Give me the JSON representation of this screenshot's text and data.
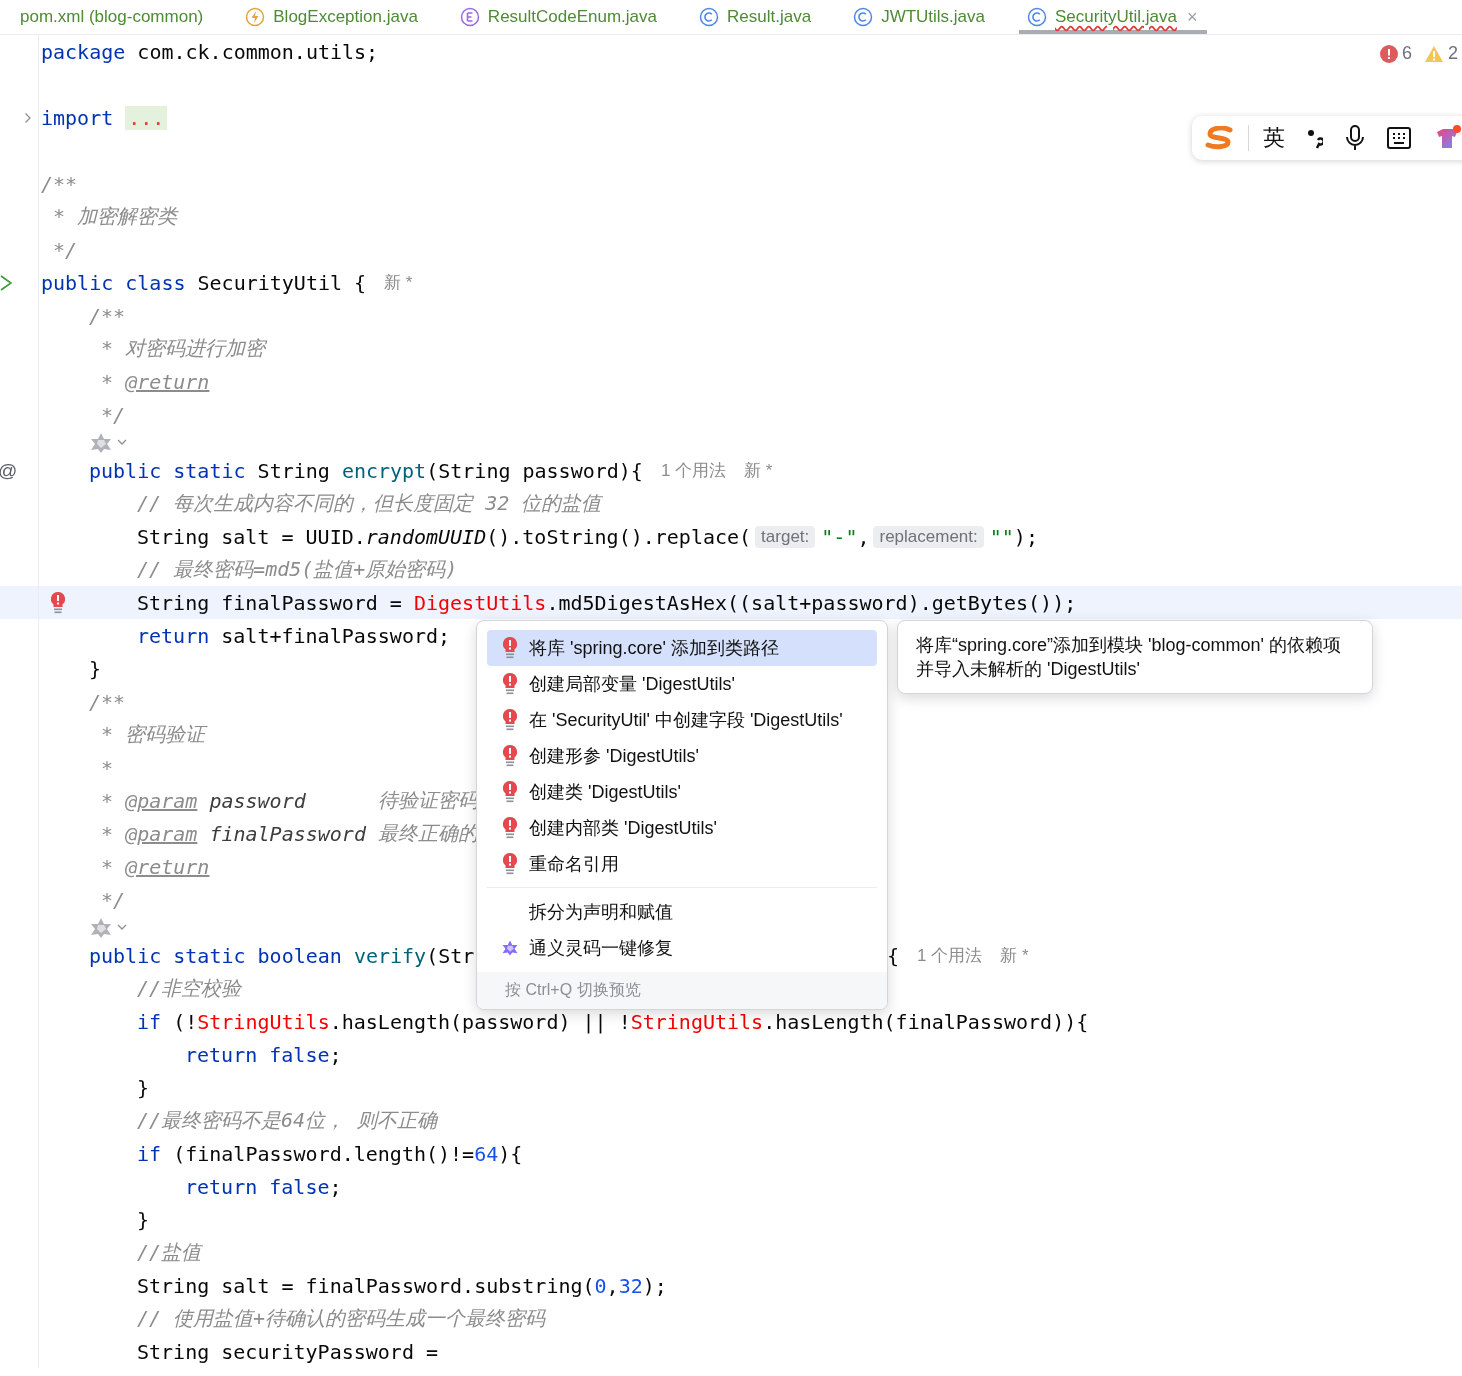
{
  "tabs": [
    {
      "kind": "xml",
      "label": "pom.xml (blog-common)",
      "selected": false,
      "has_error": false
    },
    {
      "kind": "exception",
      "label": "BlogException.java",
      "selected": false,
      "has_error": false
    },
    {
      "kind": "enum",
      "label": "ResultCodeEnum.java",
      "selected": false,
      "has_error": false
    },
    {
      "kind": "class",
      "label": "Result.java",
      "selected": false,
      "has_error": false
    },
    {
      "kind": "class",
      "label": "JWTUtils.java",
      "selected": false,
      "has_error": false
    },
    {
      "kind": "class",
      "label": "SecurityUtil.java",
      "selected": true,
      "has_error": true,
      "close": "×"
    }
  ],
  "problems": {
    "errors": "6",
    "warnings": "2"
  },
  "ime_toolbar": {
    "mode": "英"
  },
  "lines": [
    {
      "kind": "code",
      "tokens": [
        {
          "kind": "kw",
          "t": "package"
        },
        {
          "kind": "plain",
          "t": " com.ck.common.utils;"
        }
      ]
    },
    {
      "kind": "blank"
    },
    {
      "kind": "code",
      "gutter": {
        "kind": "fold"
      },
      "tokens": [
        {
          "kind": "kw",
          "t": "import"
        },
        {
          "kind": "fold",
          "t": "..."
        }
      ]
    },
    {
      "kind": "blank"
    },
    {
      "kind": "code",
      "tokens": [
        {
          "kind": "cmt",
          "t": "/**"
        }
      ]
    },
    {
      "kind": "code",
      "tokens": [
        {
          "kind": "cmt",
          "t": " * 加密解密类"
        }
      ]
    },
    {
      "kind": "code",
      "tokens": [
        {
          "kind": "cmt",
          "t": " */"
        }
      ]
    },
    {
      "kind": "code",
      "gutter": {
        "kind": "run"
      },
      "tokens": [
        {
          "kind": "kw",
          "t": "public class"
        },
        {
          "kind": "plain",
          "t": " SecurityUtil {"
        },
        {
          "kind": "meta",
          "t": "新 *"
        }
      ],
      "children": [
        {
          "kind": "code",
          "tokens": [
            {
              "kind": "cmt",
              "t": "/**"
            }
          ]
        },
        {
          "kind": "code",
          "tokens": [
            {
              "kind": "cmt",
              "t": " * 对密码进行加密"
            }
          ]
        },
        {
          "kind": "code",
          "tokens": [
            {
              "kind": "cmt",
              "t": " * "
            },
            {
              "kind": "tag",
              "t": "@return"
            }
          ]
        },
        {
          "kind": "code",
          "tokens": [
            {
              "kind": "cmt",
              "t": " */"
            }
          ]
        },
        {
          "kind": "inlay"
        },
        {
          "kind": "code",
          "gutter": {
            "kind": "mark",
            "text": "@"
          },
          "tokens": [
            {
              "kind": "kw",
              "t": "public static"
            },
            {
              "kind": "plain",
              "t": " String "
            },
            {
              "kind": "fn",
              "t": "encrypt"
            },
            {
              "kind": "plain",
              "t": "(String password){"
            },
            {
              "kind": "meta",
              "t": "1 个用法"
            },
            {
              "kind": "meta",
              "t": "新 *"
            }
          ],
          "children": [
            {
              "kind": "code",
              "tokens": [
                {
                  "kind": "cmt",
                  "t": "// 每次生成内容不同的，但长度固定 32 位的盐值"
                }
              ]
            },
            {
              "kind": "code",
              "tokens": [
                {
                  "kind": "plain",
                  "t": "String salt = UUID."
                },
                {
                  "kind": "ital",
                  "t": "randomUUID"
                },
                {
                  "kind": "plain",
                  "t": "().toString().replace("
                },
                {
                  "kind": "hint",
                  "t": "target:"
                },
                {
                  "kind": "str",
                  "t": "\"-\""
                },
                {
                  "kind": "plain",
                  "t": ","
                },
                {
                  "kind": "hint",
                  "t": "replacement:"
                },
                {
                  "kind": "str",
                  "t": "\"\""
                },
                {
                  "kind": "plain",
                  "t": ");"
                }
              ]
            },
            {
              "kind": "code",
              "tokens": [
                {
                  "kind": "cmt",
                  "t": "// 最终密码=md5(盐值+原始密码)"
                }
              ]
            },
            {
              "kind": "code",
              "current": true,
              "error_bulb": true,
              "tokens": [
                {
                  "kind": "plain",
                  "t": "String finalPassword = "
                },
                {
                  "kind": "err",
                  "t": "DigestUtils"
                },
                {
                  "kind": "plain",
                  "t": ".md5DigestAsHex((salt+password).getBytes());"
                }
              ]
            },
            {
              "kind": "code",
              "tokens": [
                {
                  "kind": "kw",
                  "t": "return"
                },
                {
                  "kind": "plain",
                  "t": " salt+finalPassword;"
                }
              ]
            }
          ]
        },
        {
          "kind": "code",
          "tokens": [
            {
              "kind": "plain",
              "t": "}"
            }
          ]
        },
        {
          "kind": "code",
          "tokens": [
            {
              "kind": "cmt",
              "t": "/**"
            }
          ]
        },
        {
          "kind": "code",
          "tokens": [
            {
              "kind": "cmt",
              "t": " * 密码验证"
            }
          ]
        },
        {
          "kind": "code",
          "tokens": [
            {
              "kind": "cmt",
              "t": " *"
            }
          ]
        },
        {
          "kind": "code",
          "tokens": [
            {
              "kind": "cmt",
              "t": " * "
            },
            {
              "kind": "tag",
              "t": "@param"
            },
            {
              "kind": "docp",
              "t": " password"
            },
            {
              "kind": "cmt",
              "t": "      待验证密码"
            }
          ]
        },
        {
          "kind": "code",
          "tokens": [
            {
              "kind": "cmt",
              "t": " * "
            },
            {
              "kind": "tag",
              "t": "@param"
            },
            {
              "kind": "docp",
              "t": " finalPassword"
            },
            {
              "kind": "cmt",
              "t": " 最终正确的"
            }
          ]
        },
        {
          "kind": "code",
          "tokens": [
            {
              "kind": "cmt",
              "t": " * "
            },
            {
              "kind": "tag",
              "t": "@return"
            }
          ]
        },
        {
          "kind": "code",
          "tokens": [
            {
              "kind": "cmt",
              "t": " */"
            }
          ]
        },
        {
          "kind": "inlay"
        },
        {
          "kind": "code",
          "tokens": [
            {
              "kind": "kw",
              "t": "public static boolean"
            },
            {
              "kind": "fn",
              "t": " verify"
            },
            {
              "kind": "plain",
              "t": "(Str"
            }
          ],
          "after": [
            {
              "kind": "plain",
              "t": "{"
            },
            {
              "kind": "meta",
              "t": "1 个用法"
            },
            {
              "kind": "meta",
              "t": "新 *"
            }
          ],
          "children": [
            {
              "kind": "code",
              "tokens": [
                {
                  "kind": "cmt",
                  "t": "//非空校验"
                }
              ]
            },
            {
              "kind": "code",
              "tokens": [
                {
                  "kind": "kw",
                  "t": "if"
                },
                {
                  "kind": "plain",
                  "t": " (!"
                },
                {
                  "kind": "err",
                  "t": "StringUtils"
                },
                {
                  "kind": "plain",
                  "t": ".hasLength(password) || !"
                },
                {
                  "kind": "err",
                  "t": "StringUtils"
                },
                {
                  "kind": "plain",
                  "t": ".hasLength(finalPassword)){"
                }
              ],
              "children": [
                {
                  "kind": "code",
                  "tokens": [
                    {
                      "kind": "kw",
                      "t": "return false"
                    },
                    {
                      "kind": "plain",
                      "t": ";"
                    }
                  ]
                }
              ]
            },
            {
              "kind": "code",
              "tokens": [
                {
                  "kind": "plain",
                  "t": "}"
                }
              ]
            },
            {
              "kind": "code",
              "tokens": [
                {
                  "kind": "cmt",
                  "t": "//最终密码不是64位， 则不正确"
                }
              ]
            },
            {
              "kind": "code",
              "tokens": [
                {
                  "kind": "kw",
                  "t": "if"
                },
                {
                  "kind": "plain",
                  "t": " (finalPassword.length()!="
                },
                {
                  "kind": "num",
                  "t": "64"
                },
                {
                  "kind": "plain",
                  "t": "){"
                }
              ],
              "children": [
                {
                  "kind": "code",
                  "tokens": [
                    {
                      "kind": "kw",
                      "t": "return false"
                    },
                    {
                      "kind": "plain",
                      "t": ";"
                    }
                  ]
                }
              ]
            },
            {
              "kind": "code",
              "tokens": [
                {
                  "kind": "plain",
                  "t": "}"
                }
              ]
            },
            {
              "kind": "code",
              "tokens": [
                {
                  "kind": "cmt",
                  "t": "//盐值"
                }
              ]
            },
            {
              "kind": "code",
              "tokens": [
                {
                  "kind": "plain",
                  "t": "String salt = finalPassword.substring("
                },
                {
                  "kind": "num",
                  "t": "0"
                },
                {
                  "kind": "plain",
                  "t": ","
                },
                {
                  "kind": "num",
                  "t": "32"
                },
                {
                  "kind": "plain",
                  "t": ");"
                }
              ]
            },
            {
              "kind": "code",
              "tokens": [
                {
                  "kind": "cmt",
                  "t": "// 使用盐值+待确认的密码生成一个最终密码"
                }
              ]
            },
            {
              "kind": "code",
              "tokens": [
                {
                  "kind": "plain",
                  "t": "String securityPassword ="
                }
              ]
            }
          ]
        }
      ]
    }
  ],
  "quick_fix_menu": {
    "items": [
      {
        "kind": "error",
        "label": "将库 'spring.core' 添加到类路径",
        "selected": true
      },
      {
        "kind": "error",
        "label": "创建局部变量 'DigestUtils'",
        "selected": false
      },
      {
        "kind": "error",
        "label": "在 'SecurityUtil' 中创建字段 'DigestUtils'",
        "selected": false
      },
      {
        "kind": "error",
        "label": "创建形参 'DigestUtils'",
        "selected": false
      },
      {
        "kind": "error",
        "label": "创建类 'DigestUtils'",
        "selected": false
      },
      {
        "kind": "error",
        "label": "创建内部类 'DigestUtils'",
        "selected": false
      },
      {
        "kind": "error",
        "label": "重命名引用",
        "selected": false
      },
      {
        "kind": "separator"
      },
      {
        "kind": "plain",
        "label": "拆分为声明和赋值",
        "selected": false
      },
      {
        "kind": "ai",
        "label": "通义灵码一键修复",
        "selected": false
      }
    ],
    "footer": "按 Ctrl+Q 切换预览"
  },
  "preview_tooltip": "将库“spring.core”添加到模块 'blog-common' 的依赖项并导入未解析的 'DigestUtils'"
}
